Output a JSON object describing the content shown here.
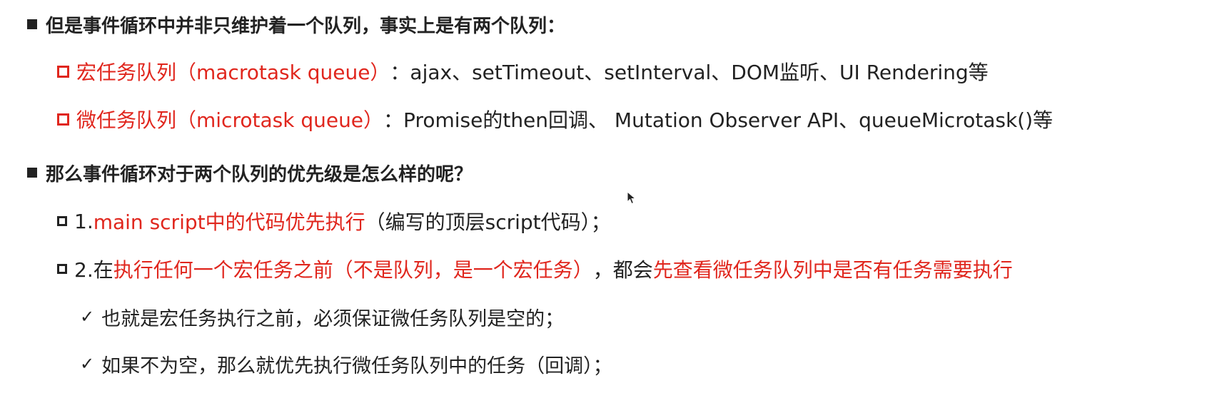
{
  "accent_color": "#e0261d",
  "text_color": "#222222",
  "section1": {
    "heading": "但是事件循环中并非只维护着一个队列，事实上是有两个队列：",
    "macro": {
      "label": "宏任务队列（macrotask queue）",
      "desc": "：ajax、setTimeout、setInterval、DOM监听、UI Rendering等"
    },
    "micro": {
      "label": "微任务队列（microtask queue）",
      "desc": "：Promise的then回调、 Mutation Observer API、queueMicrotask()等"
    }
  },
  "section2": {
    "heading": "那么事件循环对于两个队列的优先级是怎么样的呢？",
    "item1": {
      "prefix": "1.",
      "highlight": "main script中的代码优先执行",
      "rest": "（编写的顶层script代码）；"
    },
    "item2": {
      "prefix": "2.在",
      "highlight1": "执行任何一个宏任务之前（不是队列，是一个宏任务）",
      "middle": "，都会",
      "highlight2": "先查看微任务队列中是否有任务需要执行"
    },
    "sub1": "也就是宏任务执行之前，必须保证微任务队列是空的；",
    "sub2": "如果不为空，那么就优先执行微任务队列中的任务（回调）；"
  }
}
